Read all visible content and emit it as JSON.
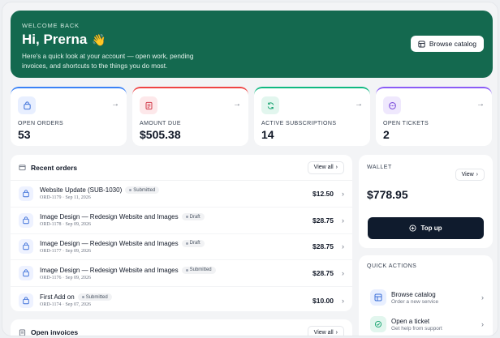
{
  "hero": {
    "eyebrow": "WELCOME BACK",
    "greeting": "Hi, Prerna",
    "wave": "👋",
    "subtitle": "Here's a quick look at your account — open work, pending invoices, and shortcuts to the things you do most.",
    "browse_label": "Browse catalog"
  },
  "stats": [
    {
      "label": "OPEN ORDERS",
      "value": "53",
      "accent": "#3b82f6",
      "icon": "bag-icon"
    },
    {
      "label": "AMOUNT DUE",
      "value": "$505.38",
      "accent": "#ef4444",
      "icon": "receipt-icon"
    },
    {
      "label": "ACTIVE SUBSCRIPTIONS",
      "value": "14",
      "accent": "#10b981",
      "icon": "refresh-icon"
    },
    {
      "label": "OPEN TICKETS",
      "value": "2",
      "accent": "#8b5cf6",
      "icon": "chat-icon"
    }
  ],
  "orders": {
    "title": "Recent orders",
    "view_all": "View all",
    "rows": [
      {
        "name": "Website Update (SUB-1030)",
        "status": "Submitted",
        "meta": "ORD-1179 · Sep 11, 2026",
        "amount": "$12.50"
      },
      {
        "name": "Image Design — Redesign Website and Images",
        "status": "Draft",
        "meta": "ORD-1178 · Sep 09, 2026",
        "amount": "$28.75"
      },
      {
        "name": "Image Design — Redesign Website and Images",
        "status": "Draft",
        "meta": "ORD-1177 · Sep 09, 2026",
        "amount": "$28.75"
      },
      {
        "name": "Image Design — Redesign Website and Images",
        "status": "Submitted",
        "meta": "ORD-1176 · Sep 09, 2026",
        "amount": "$28.75"
      },
      {
        "name": "First Add on",
        "status": "Submitted",
        "meta": "ORD-1174 · Sep 07, 2026",
        "amount": "$10.00"
      }
    ]
  },
  "invoices": {
    "title": "Open invoices",
    "view_all": "View all"
  },
  "wallet": {
    "label": "WALLET",
    "view": "View",
    "amount": "$778.95",
    "topup": "Top up"
  },
  "quick": {
    "label": "QUICK ACTIONS",
    "items": [
      {
        "name": "Browse catalog",
        "sub": "Order a new service"
      },
      {
        "name": "Open a ticket",
        "sub": "Get help from support"
      }
    ]
  }
}
